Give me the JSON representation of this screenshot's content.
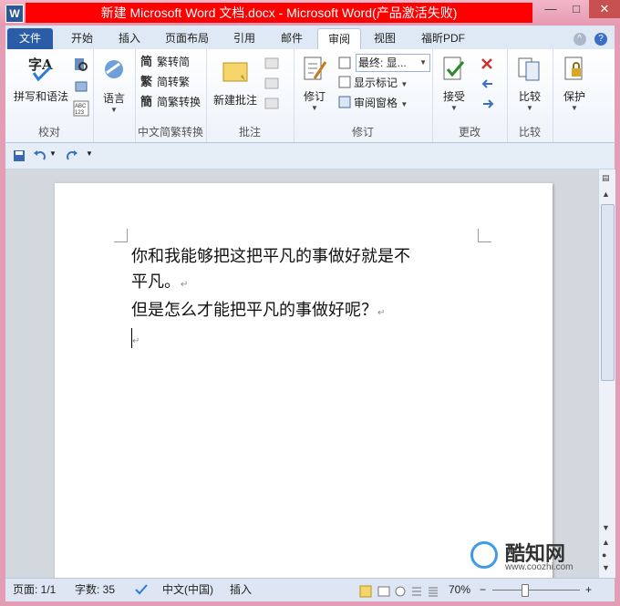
{
  "window": {
    "title": "新建 Microsoft Word 文档.docx - Microsoft Word(产品激活失败)",
    "app_icon_letter": "W",
    "minimize_glyph": "—",
    "maximize_glyph": "□",
    "close_glyph": "✕"
  },
  "tabs": [
    "文件",
    "开始",
    "插入",
    "页面布局",
    "引用",
    "邮件",
    "审阅",
    "视图",
    "福昕PDF"
  ],
  "active_tab": "审阅",
  "tab_help_glyph": "?",
  "ribbon": {
    "proofing": {
      "spelling": "拼写和语法",
      "label": "校对"
    },
    "language": {
      "button": "语言"
    },
    "chinese_conversion": {
      "trad_to_simp": "繁转简",
      "simp_to_trad": "简转繁",
      "convert": "简繁转换",
      "label": "中文简繁转换"
    },
    "comments": {
      "new_comment": "新建批注",
      "label": "批注"
    },
    "tracking": {
      "track_changes": "修订",
      "display_for_review": "最终: 显...",
      "show_markup": "显示标记",
      "reviewing_pane": "审阅窗格",
      "label": "修订"
    },
    "changes": {
      "accept": "接受",
      "label": "更改"
    },
    "compare": {
      "compare": "比较",
      "label": "比较"
    },
    "protect": {
      "protect": "保护"
    }
  },
  "document": {
    "line1": "你和我能够把这把平凡的事做好就是不",
    "line2": "平凡。",
    "line3": "但是怎么才能把平凡的事做好呢？",
    "paragraph_mark": "↵"
  },
  "statusbar": {
    "page": "页面: 1/1",
    "words": "字数: 35",
    "language": "中文(中国)",
    "mode": "插入",
    "zoom": "70%",
    "zoom_minus": "−",
    "zoom_plus": "+"
  },
  "watermark": {
    "name": "酷知网",
    "url": "www.coozhi.com"
  },
  "icons": [
    "word-app-icon",
    "save-icon",
    "undo-icon",
    "redo-icon",
    "spelling-icon",
    "language-icon",
    "comment-icon",
    "track-changes-icon",
    "accept-icon",
    "compare-icon",
    "protect-icon",
    "help-icon"
  ]
}
